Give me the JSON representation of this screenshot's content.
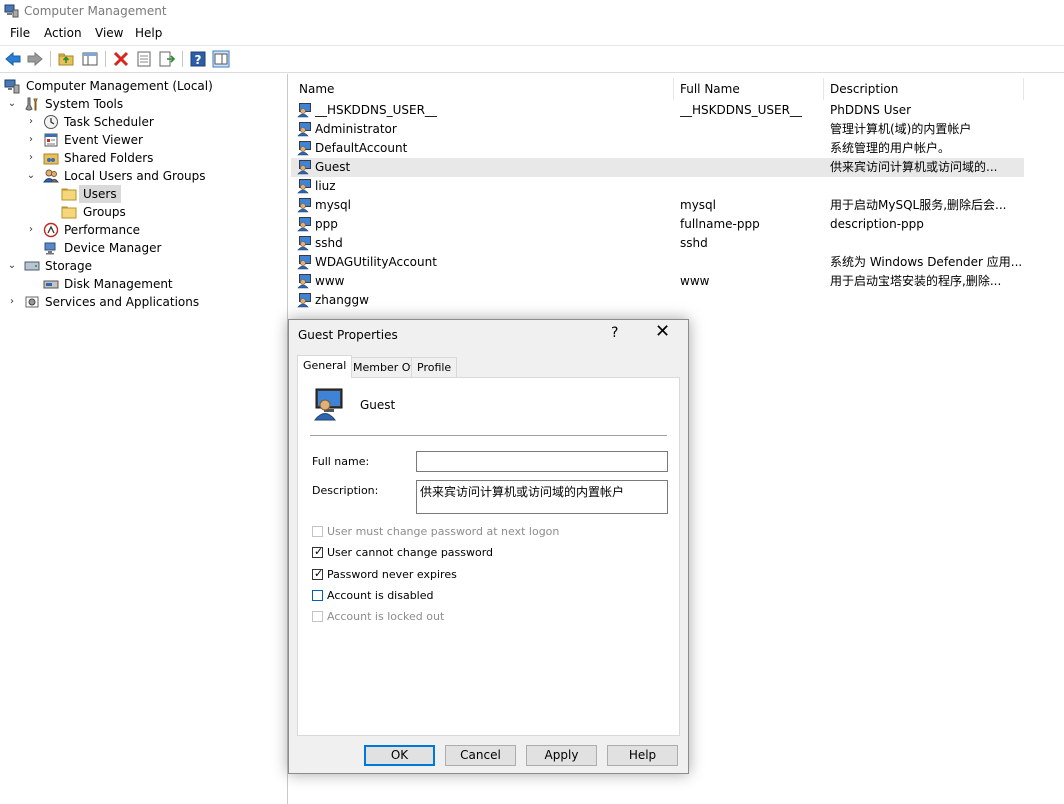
{
  "window": {
    "title": "Computer Management"
  },
  "menu": [
    "File",
    "Action",
    "View",
    "Help"
  ],
  "toolbar": [
    "back-icon",
    "forward-icon",
    "up-folder-icon",
    "show-hide-tree-icon",
    "delete-icon",
    "properties-icon",
    "export-list-icon",
    "help-icon",
    "show-hide-action-pane-icon"
  ],
  "tree": [
    {
      "label": "Computer Management (Local)",
      "icon": "computer-management-icon",
      "level": 0,
      "expander": ""
    },
    {
      "label": "System Tools",
      "icon": "tools-icon",
      "level": 1,
      "expander": "v"
    },
    {
      "label": "Task Scheduler",
      "icon": "clock-icon",
      "level": 2,
      "expander": ">"
    },
    {
      "label": "Event Viewer",
      "icon": "event-viewer-icon",
      "level": 2,
      "expander": ">"
    },
    {
      "label": "Shared Folders",
      "icon": "shared-folder-icon",
      "level": 2,
      "expander": ">"
    },
    {
      "label": "Local Users and Groups",
      "icon": "users-groups-icon",
      "level": 2,
      "expander": "v"
    },
    {
      "label": "Users",
      "icon": "folder-icon",
      "level": 3,
      "expander": "",
      "selected": true
    },
    {
      "label": "Groups",
      "icon": "folder-icon",
      "level": 3,
      "expander": ""
    },
    {
      "label": "Performance",
      "icon": "performance-icon",
      "level": 2,
      "expander": ">"
    },
    {
      "label": "Device Manager",
      "icon": "device-manager-icon",
      "level": 2,
      "expander": ""
    },
    {
      "label": "Storage",
      "icon": "storage-icon",
      "level": 1,
      "expander": "v"
    },
    {
      "label": "Disk Management",
      "icon": "disk-icon",
      "level": 2,
      "expander": ""
    },
    {
      "label": "Services and Applications",
      "icon": "services-icon",
      "level": 1,
      "expander": ">"
    }
  ],
  "list": {
    "columns": [
      "Name",
      "Full Name",
      "Description"
    ],
    "rows": [
      {
        "name": "__HSKDDNS_USER__",
        "full_name": "__HSKDDNS_USER__",
        "description": "PhDDNS User"
      },
      {
        "name": "Administrator",
        "full_name": "",
        "description": "管理计算机(域)的内置帐户"
      },
      {
        "name": "DefaultAccount",
        "full_name": "",
        "description": "系统管理的用户帐户。"
      },
      {
        "name": "Guest",
        "full_name": "",
        "description": "供来宾访问计算机或访问域的...",
        "highlight": true
      },
      {
        "name": "liuz",
        "full_name": "",
        "description": ""
      },
      {
        "name": "mysql",
        "full_name": "mysql",
        "description": "用于启动MySQL服务,删除后会..."
      },
      {
        "name": "ppp",
        "full_name": "fullname-ppp",
        "description": "description-ppp"
      },
      {
        "name": "sshd",
        "full_name": "sshd",
        "description": ""
      },
      {
        "name": "WDAGUtilityAccount",
        "full_name": "",
        "description": "系统为 Windows Defender 应用..."
      },
      {
        "name": "www",
        "full_name": "www",
        "description": "用于启动宝塔安装的程序,删除..."
      },
      {
        "name": "zhanggw",
        "full_name": "",
        "description": ""
      }
    ]
  },
  "dialog": {
    "title": "Guest Properties",
    "help_glyph": "?",
    "close_glyph": "✕",
    "tabs": [
      {
        "label": "General",
        "active": true
      },
      {
        "label": "Member Of",
        "active": false
      },
      {
        "label": "Profile",
        "active": false
      }
    ],
    "user_name": "Guest",
    "full_name_label": "Full name:",
    "full_name_value": "",
    "description_label": "Description:",
    "description_value": "供来宾访问计算机或访问域的内置帐户",
    "checkboxes": [
      {
        "label": "User must change password at next logon",
        "checked": false,
        "enabled": false
      },
      {
        "label": "User cannot change password",
        "checked": true,
        "enabled": true
      },
      {
        "label": "Password never expires",
        "checked": true,
        "enabled": true
      },
      {
        "label": "Account is disabled",
        "checked": false,
        "enabled": true,
        "focused": true
      },
      {
        "label": "Account is locked out",
        "checked": false,
        "enabled": false
      }
    ],
    "buttons": {
      "ok": "OK",
      "cancel": "Cancel",
      "apply": "Apply",
      "help": "Help"
    }
  }
}
